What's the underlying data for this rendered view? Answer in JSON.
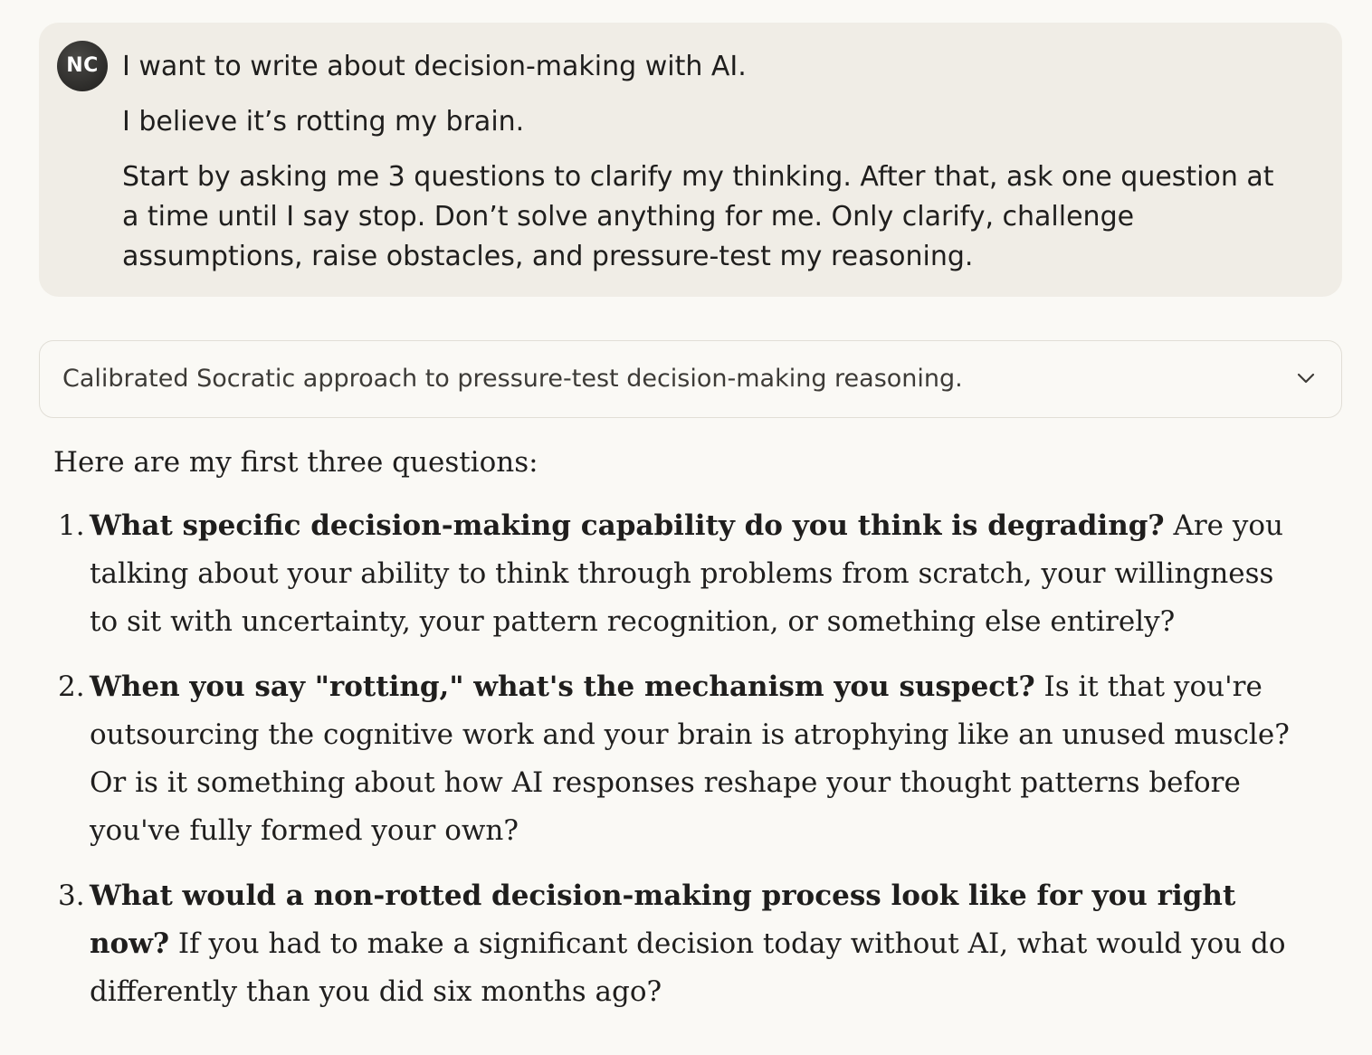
{
  "user_message": {
    "avatar_initials": "NC",
    "paragraphs": [
      "I want to write about decision-making with AI.",
      "I believe it’s rotting my brain.",
      "Start by asking me 3 questions to clarify my thinking. After that, ask one question at a time until I say stop. Don’t solve anything for me. Only clarify, challenge assumptions, raise obstacles, and pressure-test my reasoning."
    ]
  },
  "thinking": {
    "summary": "Calibrated Socratic approach to pressure-test decision-making reasoning.",
    "toggle_icon": "chevron-down-icon"
  },
  "assistant_message": {
    "intro": "Here are my first three questions:",
    "questions": [
      {
        "number": "1.",
        "bold": "What specific decision-making capability do you think is degrading?",
        "text": " Are you talking about your ability to think through problems from scratch, your willingness to sit with uncertainty, your pattern recognition, or something else entirely?"
      },
      {
        "number": "2.",
        "bold": "When you say \"rotting,\" what's the mechanism you suspect?",
        "text": " Is it that you're outsourcing the cognitive work and your brain is atrophying like an unused muscle? Or is it something about how AI responses reshape your thought patterns before you've fully formed your own?"
      },
      {
        "number": "3.",
        "bold": "What would a non-rotted decision-making process look like for you right now?",
        "text": " If you had to make a significant decision today without AI, what would you do differently than you did six months ago?"
      }
    ]
  },
  "colors": {
    "page_background": "#faf9f5",
    "user_bubble": "#f0ede6",
    "avatar": "#2c2b29",
    "text": "#1f1e1d",
    "border": "#e1ded6"
  }
}
